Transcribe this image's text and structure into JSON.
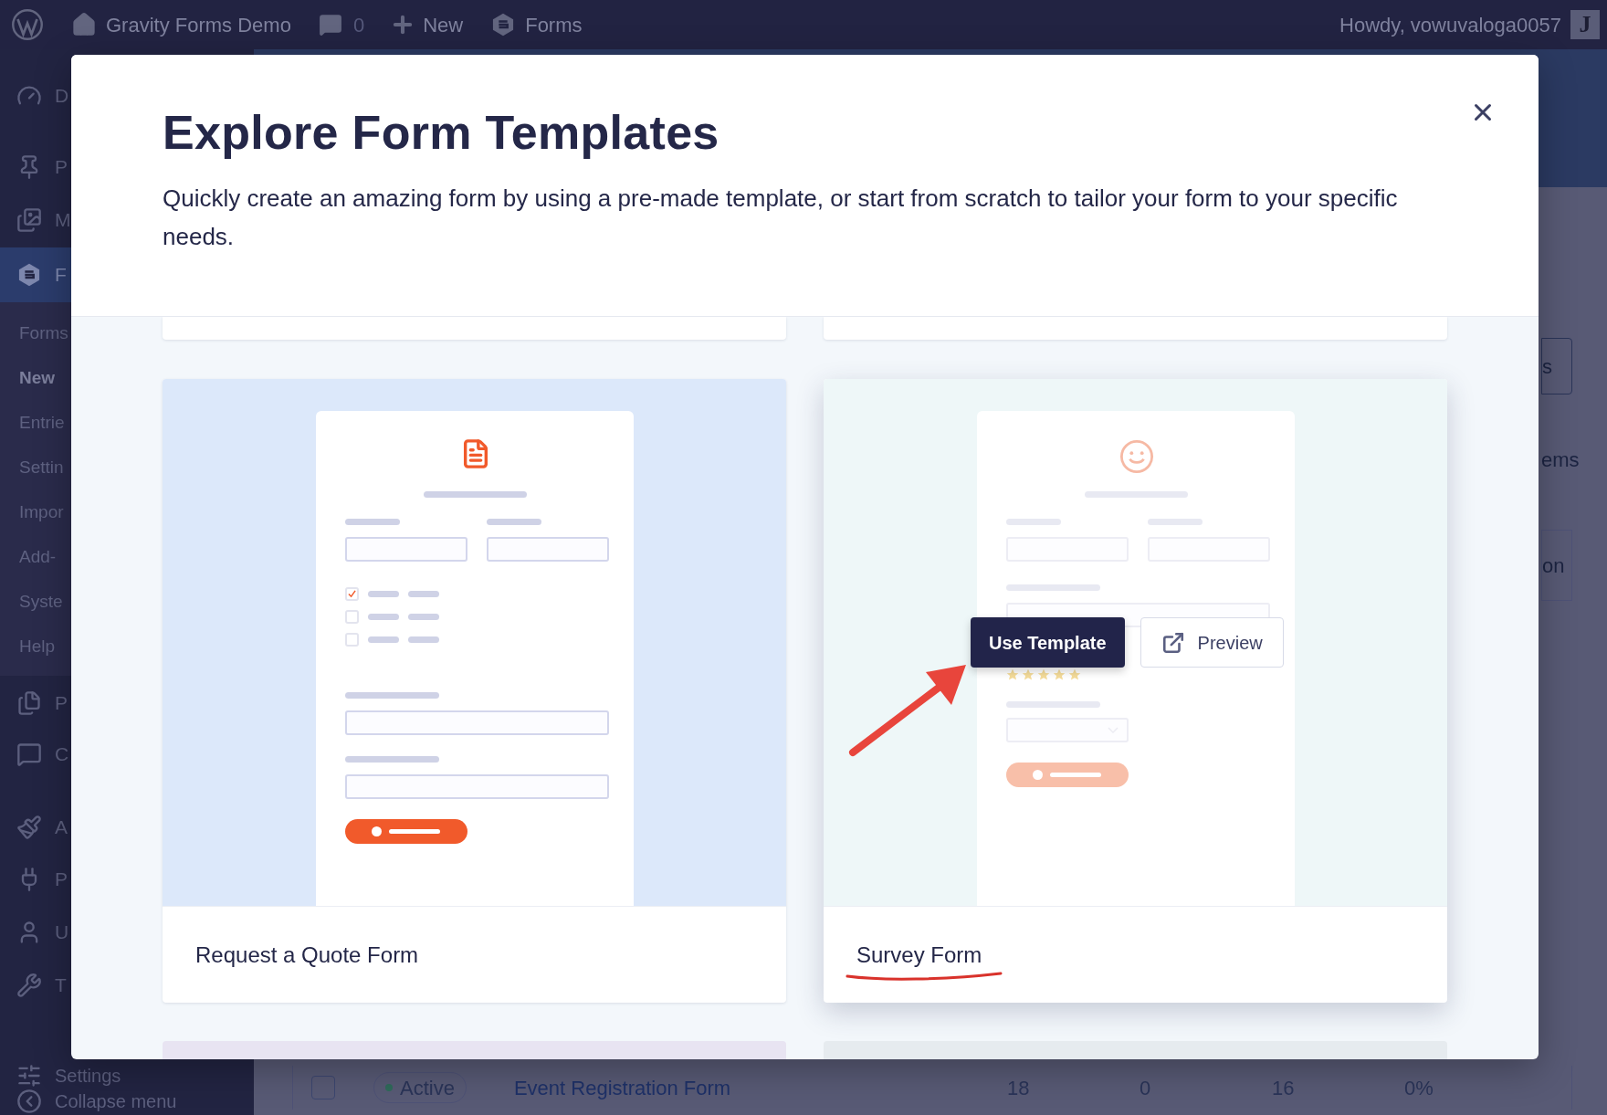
{
  "admin_bar": {
    "site_name": "Gravity Forms Demo",
    "comments_count": "0",
    "new_label": "New",
    "forms_label": "Forms",
    "greeting": "Howdy, vowuvaloga0057",
    "avatar_letter": "J"
  },
  "sidebar": {
    "menu": [
      {
        "label": "D",
        "selected": false
      },
      {
        "label": "P",
        "selected": false
      },
      {
        "label": "M",
        "selected": false
      },
      {
        "label": "F",
        "selected": true,
        "submenu": [
          {
            "label": "Forms",
            "selected": false
          },
          {
            "label": "New",
            "selected": true
          },
          {
            "label": "Entrie",
            "selected": false
          },
          {
            "label": "Settin",
            "selected": false
          },
          {
            "label": "Impor",
            "selected": false
          },
          {
            "label": "Add-",
            "selected": false
          },
          {
            "label": "Syste",
            "selected": false
          },
          {
            "label": "Help",
            "selected": false
          }
        ]
      },
      {
        "label": "P",
        "selected": false
      },
      {
        "label": "C",
        "selected": false
      },
      {
        "label": "A",
        "selected": false
      },
      {
        "label": "P",
        "selected": false
      },
      {
        "label": "U",
        "selected": false
      },
      {
        "label": "T",
        "selected": false
      },
      {
        "label": "Settings",
        "selected": false
      },
      {
        "label": "Collapse menu",
        "selected": false
      }
    ]
  },
  "background": {
    "button_fragment": "s",
    "text_fragment": "ems",
    "column_fragment": "on",
    "row": {
      "checked": false,
      "status": "Active",
      "title": "Event Registration Form",
      "cells": [
        "18",
        "0",
        "16",
        "0%"
      ]
    }
  },
  "modal": {
    "title": "Explore Form Templates",
    "description": "Quickly create an amazing form by using a pre-made template, or start from scratch to tailor your form to your specific needs.",
    "templates": [
      {
        "name": "Request a Quote Form",
        "kind": "quote",
        "hovered": false
      },
      {
        "name": "Survey Form",
        "kind": "survey",
        "hovered": true
      }
    ],
    "use_template_label": "Use Template",
    "preview_label": "Preview"
  }
}
